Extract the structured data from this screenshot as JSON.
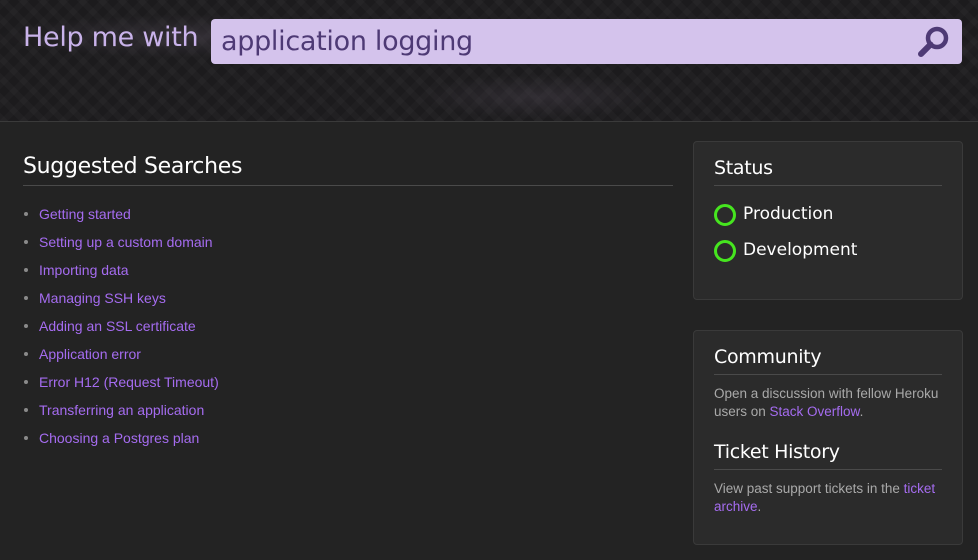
{
  "header": {
    "help_label": "Help me with",
    "search_value": "application logging",
    "search_icon": "magnifier-icon",
    "accent_color": "#d4c3ec"
  },
  "suggested": {
    "title": "Suggested Searches",
    "items": [
      "Getting started",
      "Setting up a custom domain",
      "Importing data",
      "Managing SSH keys",
      "Adding an SSL certificate",
      "Application error",
      "Error H12 (Request Timeout)",
      "Transferring an application",
      "Choosing a Postgres plan"
    ]
  },
  "status": {
    "title": "Status",
    "items": [
      {
        "label": "Production",
        "state_color": "#46e51f"
      },
      {
        "label": "Development",
        "state_color": "#46e51f"
      }
    ]
  },
  "community": {
    "title": "Community",
    "text_before": "Open a discussion with fellow Heroku users on ",
    "link": "Stack Overflow",
    "text_after": "."
  },
  "tickets": {
    "title": "Ticket History",
    "text_before": "View past support tickets in the ",
    "link": "ticket archive",
    "text_after": "."
  },
  "colors": {
    "link": "#a56cf0",
    "status_ok": "#46e51f"
  }
}
